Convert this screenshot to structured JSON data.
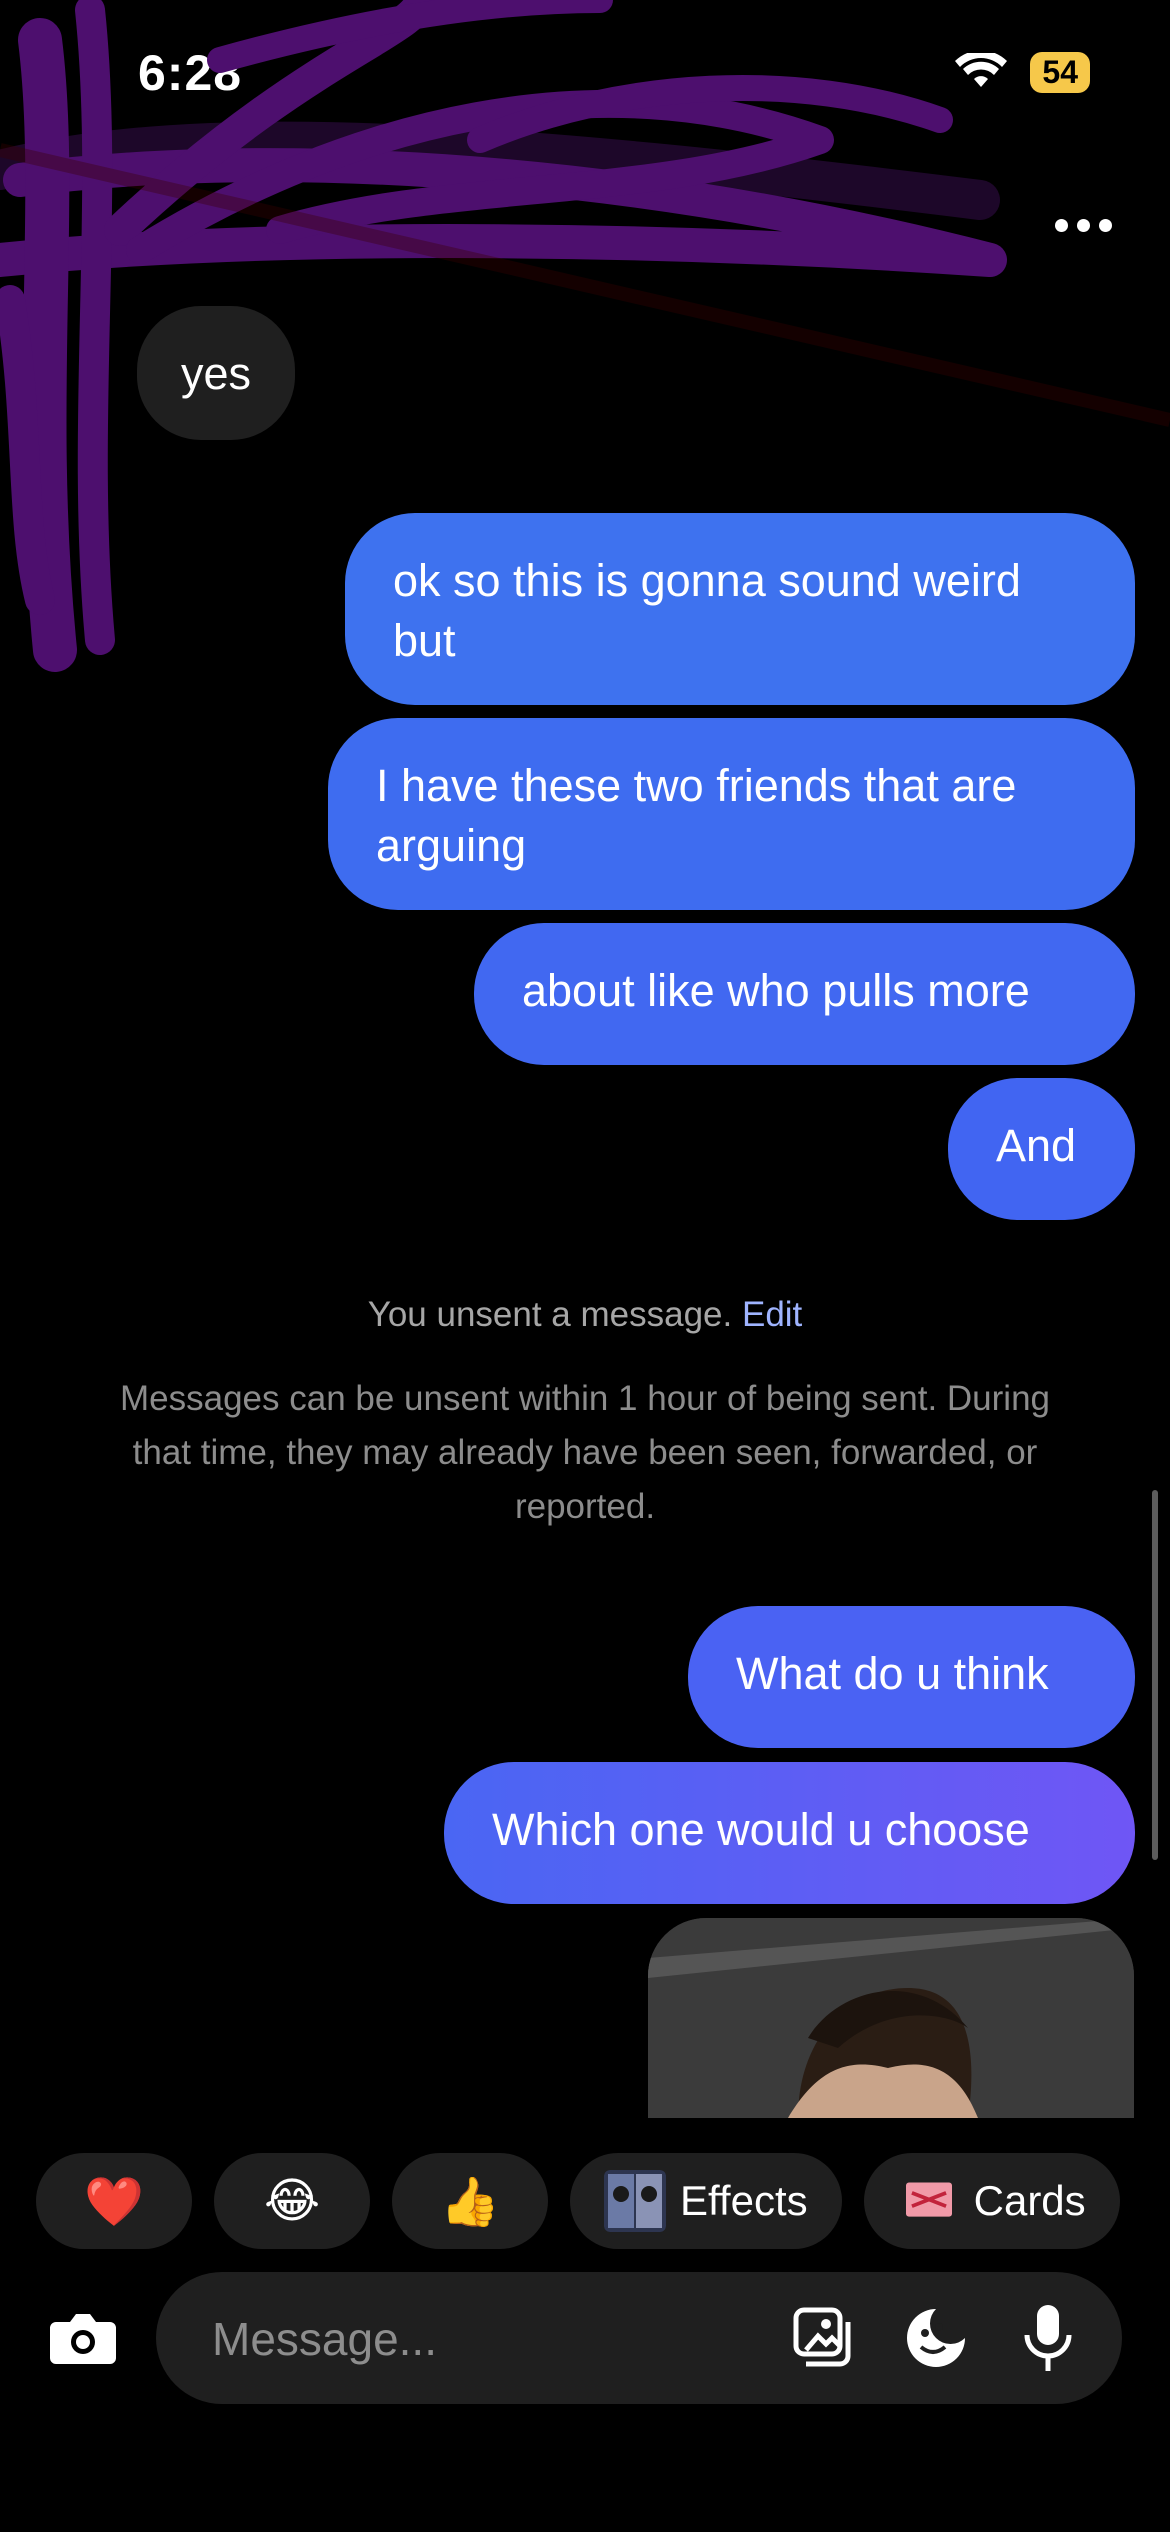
{
  "status": {
    "time": "6:28",
    "battery": "54"
  },
  "header": {
    "more_icon": "more-horizontal-icon"
  },
  "messages": {
    "incoming": [
      "yes"
    ],
    "outgoing_1": "ok so this is gonna sound weird but",
    "outgoing_2": "I have these two friends that are arguing",
    "outgoing_3": "about like who pulls more",
    "outgoing_4": "And",
    "outgoing_5": "What do u think",
    "outgoing_6": "Which one would u choose"
  },
  "unsent": {
    "text": "You unsent a message.",
    "edit_label": "Edit",
    "note": "Messages can be unsent within 1 hour of being sent. During that time, they may already have been seen, forwarded, or reported."
  },
  "quick_reactions": {
    "heart": "❤️",
    "laugh": "😂",
    "thumbs": "👍",
    "effects_label": "Effects",
    "cards_label": "Cards"
  },
  "composer": {
    "placeholder": "Message...",
    "icons": [
      "camera-icon",
      "gallery-icon",
      "sticker-icon",
      "microphone-icon"
    ]
  },
  "colors": {
    "background": "#000000",
    "outgoing_bubble": "#3e6cf0",
    "outgoing_gradient_end": "#6f56f5",
    "incoming_bubble": "#1f1f1f",
    "battery": "#f6c84a",
    "scribble": "#4d0f6e"
  }
}
